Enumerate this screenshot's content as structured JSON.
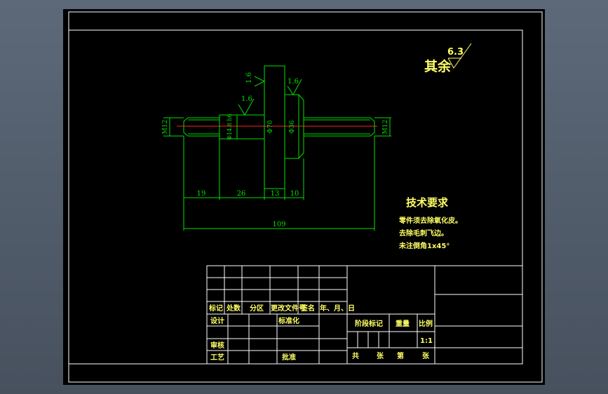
{
  "colors": {
    "background": "#000000",
    "frame": "#ffffff",
    "geometry": "#00e000",
    "centerline": "#ff2020",
    "annotation": "#ffff66"
  },
  "roughness": {
    "general_label": "其余",
    "general_value": "6.3",
    "values": [
      "1.6",
      "1.6",
      "1.6"
    ]
  },
  "dimensions": {
    "diameters": [
      "M12",
      "Φ14.8 h6",
      "Φ70",
      "Φ36",
      "M12"
    ],
    "lengths": [
      "19",
      "26",
      "13",
      "10"
    ],
    "overall": "109"
  },
  "tech_requirements": {
    "title": "技术要求",
    "lines": [
      "零件须去除氧化皮。",
      "去除毛刺飞边。",
      "未注倒角1x45°"
    ]
  },
  "title_block": {
    "header": [
      "标记",
      "处数",
      "分区",
      "更改文件号",
      "签名",
      "年、月、日"
    ],
    "design": "设计",
    "standardize": "标准化",
    "review": "审核",
    "process": "工艺",
    "approve": "批准",
    "stage_mark": "阶段标记",
    "weight": "重量",
    "scale": "比例",
    "scale_value": "1:1",
    "total": "共",
    "sheets": "张",
    "number": "第",
    "sheets2": "张"
  }
}
